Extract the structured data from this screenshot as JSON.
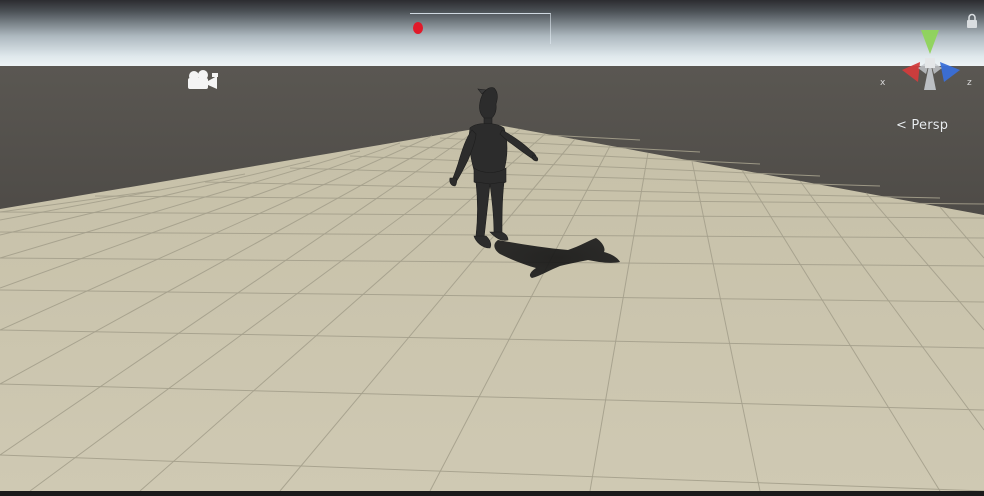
{
  "scene_view": {
    "projection_label": "< Persp",
    "gizmo": {
      "x_label": "x",
      "z_label": "z",
      "x_color": "#d23c3c",
      "y_color": "#8fd45a",
      "z_color": "#3a6fd8"
    },
    "icons": {
      "scene_camera": "camera-gizmo-icon",
      "lock": "lock-icon",
      "record_indicator": "record-dot-icon"
    },
    "colors": {
      "sky_top": "#2f2f33",
      "sky_horizon": "#e6eef2",
      "ground_far": "#4b4844",
      "plane": "#c9c3ad",
      "grid_line": "#9d9987",
      "character": "#2b2b2b",
      "shadow": "#1a1a1a"
    }
  }
}
